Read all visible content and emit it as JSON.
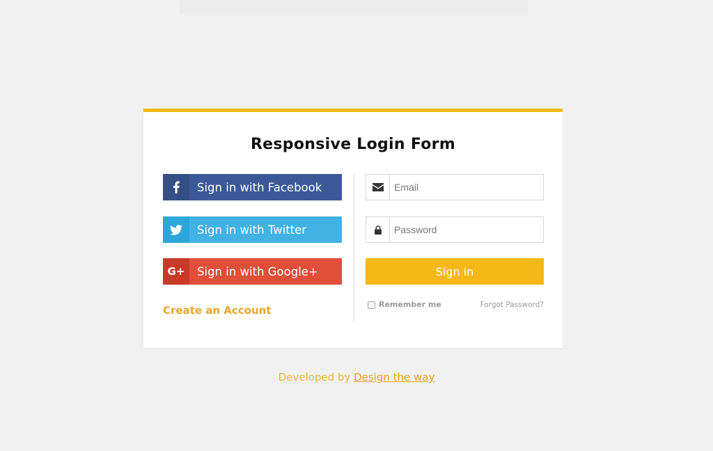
{
  "form": {
    "title": "Responsive Login Form"
  },
  "social": {
    "facebook": {
      "label": "Sign in with Facebook",
      "color": "#3b5998",
      "icon": "facebook-icon"
    },
    "twitter": {
      "label": "Sign in with Twitter",
      "color": "#41b2e3",
      "icon": "twitter-icon"
    },
    "google": {
      "label": "Sign in with Google+",
      "color": "#e14e3a",
      "icon": "google-plus-icon",
      "icon_text": "G+"
    }
  },
  "create_account": {
    "label": "Create an Account"
  },
  "login": {
    "email_placeholder": "Email",
    "email_value": "",
    "password_placeholder": "Password",
    "password_value": "",
    "submit_label": "Sign in",
    "remember_label": "Remember me",
    "forgot_label": "Forgot Password?"
  },
  "footer": {
    "prefix": "Developed by",
    "link_label": "Design the way"
  },
  "colors": {
    "accent": "#f5b817",
    "background": "#f1f1f1"
  }
}
